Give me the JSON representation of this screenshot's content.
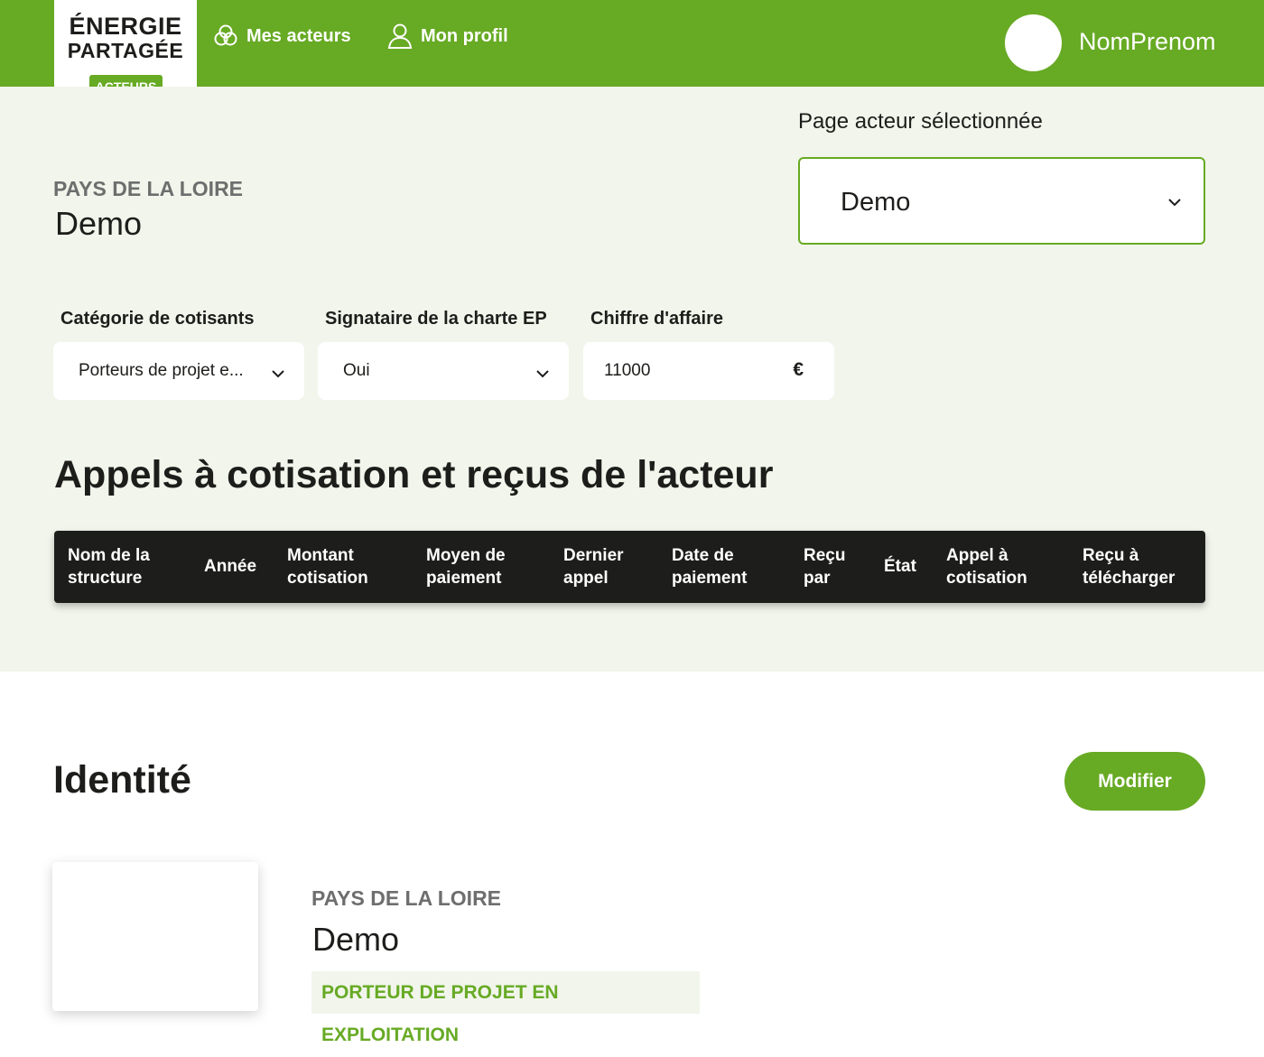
{
  "header": {
    "logo_line1": "ÉNERGIE",
    "logo_line2": "PARTAGÉE",
    "logo_badge": "ACTEURS",
    "nav": [
      {
        "label": "Mes acteurs",
        "icon": "circles-icon"
      },
      {
        "label": "Mon profil",
        "icon": "user-icon"
      }
    ],
    "username": "NomPrenom"
  },
  "actor": {
    "region": "PAYS DE LA LOIRE",
    "name": "Demo"
  },
  "selector": {
    "label": "Page acteur sélectionnée",
    "value": "Demo"
  },
  "fields": [
    {
      "label": "Catégorie de cotisants",
      "value": "Porteurs de projet e..."
    },
    {
      "label": "Signataire de la charte EP",
      "value": "Oui"
    },
    {
      "label": "Chiffre d'affaire",
      "value": "11000",
      "unit": "€"
    }
  ],
  "cotisations": {
    "title": "Appels à cotisation et reçus de l'acteur",
    "columns": [
      {
        "line1": "Nom de la",
        "line2": "structure"
      },
      {
        "line1": "Année",
        "line2": ""
      },
      {
        "line1": "Montant",
        "line2": "cotisation"
      },
      {
        "line1": "Moyen de",
        "line2": "paiement"
      },
      {
        "line1": "Dernier",
        "line2": "appel"
      },
      {
        "line1": "Date de",
        "line2": "paiement"
      },
      {
        "line1": "Reçu",
        "line2": "par"
      },
      {
        "line1": "État",
        "line2": ""
      },
      {
        "line1": "Appel à",
        "line2": "cotisation"
      },
      {
        "line1": "Reçu à",
        "line2": "télécharger"
      }
    ]
  },
  "identity": {
    "title": "Identité",
    "edit_label": "Modifier",
    "region": "PAYS DE LA LOIRE",
    "name": "Demo",
    "tag": "PORTEUR DE PROJET EN EXPLOITATION"
  },
  "colors": {
    "brand_green": "#67aa24",
    "background_light": "#f1f5eb",
    "table_header": "#1d1d1b"
  }
}
